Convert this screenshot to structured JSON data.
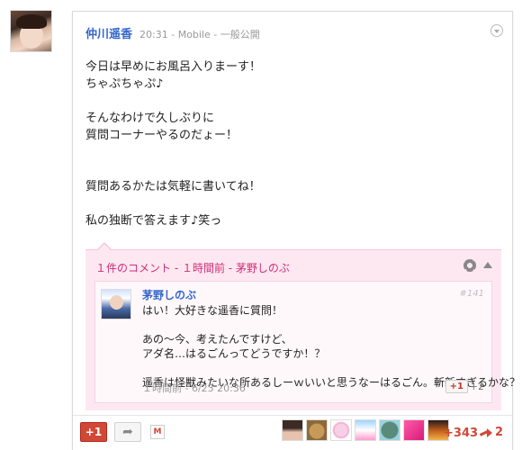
{
  "post": {
    "author": "仲川遥香",
    "time": "20:31",
    "via": "Mobile",
    "visibility": "一般公開",
    "separator": "-",
    "lines": [
      "今日は早めにお風呂入りまーす！",
      "ちゃぷちゃぷ♪",
      "",
      "そんなわけで久しぶりに",
      "質問コーナーやるのだょー！",
      "",
      "",
      "質問あるかたは気軽に書いてね！",
      "",
      "私の独断で答えます♪笑っ"
    ]
  },
  "comments": {
    "header": "１件のコメント - １時間前 - 茅野しのぶ",
    "items": [
      {
        "author": "茅野しのぶ",
        "number": "#141",
        "lines": [
          "はい！大好きな遥香に質問！",
          "",
          "あの～今、考えたんですけど、",
          "アダ名…はるごんってどうですか！？",
          "",
          "遥香は怪獣みたいな所あるしーｗいいと思うなーはるごん。斬新すぎるかな？"
        ],
        "time": "１時間前 - 6/23 20:36",
        "plusone_label": "+1",
        "plusone_count": "+2"
      }
    ]
  },
  "footer": {
    "plusone_label": "+1",
    "mail_label": "M",
    "share_count": "+343",
    "reshare_count": "2"
  },
  "icons": {
    "dropdown": "chevron-down-icon",
    "settings": "gear-icon",
    "collapse": "collapse-up-icon",
    "share": "share-arrow-icon",
    "reshare": "reshare-arrow-icon"
  },
  "colors": {
    "author_link": "#3366cc",
    "comment_accent": "#d12c76",
    "comment_bg": "#fde8f1",
    "plusone_red": "#d14836"
  }
}
